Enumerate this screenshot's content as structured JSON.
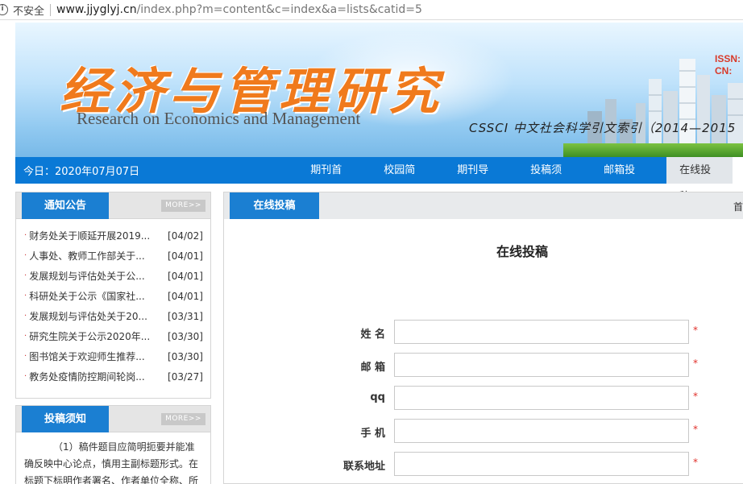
{
  "browser": {
    "security_label": "不安全",
    "url_host": "www.jjyglyj.cn",
    "url_path": "/index.php?m=content&c=index&a=lists&catid=5"
  },
  "banner": {
    "title_cn": "经济与管理研究",
    "title_en": "Research on Economics and Management",
    "index_text": "CSSCI 中文社会科学引文索引（2014—2015",
    "issn_label": "ISSN:",
    "cn_label": "CN:"
  },
  "nav": {
    "date": "今日：2020年07月07日",
    "items": [
      {
        "label": "期刊首页"
      },
      {
        "label": "校园简介"
      },
      {
        "label": "期刊导读"
      },
      {
        "label": "投稿须知"
      },
      {
        "label": "邮箱投稿"
      },
      {
        "label": "在线投稿",
        "active": true
      }
    ]
  },
  "notices": {
    "title": "通知公告",
    "more": "MORE>>",
    "items": [
      {
        "text": "财务处关于顺延开展2019...",
        "date": "[04/02]"
      },
      {
        "text": "人事处、教师工作部关于...",
        "date": "[04/01]"
      },
      {
        "text": "发展规划与评估处关于公...",
        "date": "[04/01]"
      },
      {
        "text": "科研处关于公示《国家社...",
        "date": "[04/01]"
      },
      {
        "text": "发展规划与评估处关于20...",
        "date": "[03/31]"
      },
      {
        "text": "研究生院关于公示2020年...",
        "date": "[03/30]"
      },
      {
        "text": "图书馆关于欢迎师生推荐...",
        "date": "[03/30]"
      },
      {
        "text": "教务处疫情防控期间轮岗...",
        "date": "[03/27]"
      }
    ]
  },
  "guide": {
    "title": "投稿须知",
    "more": "MORE>>",
    "text": "（1）稿件题目应简明扼要并能准确反映中心论点，慎用主副标题形式。在标题下标明作者署名、作者单位全称、所"
  },
  "main": {
    "tab": "在线投稿",
    "crumb": "首",
    "page_title": "在线投稿",
    "required_mark": "*",
    "fields": [
      {
        "label": "姓 名",
        "value": "",
        "placeholder": ""
      },
      {
        "label": "邮 箱",
        "value": "",
        "placeholder": ""
      },
      {
        "label": "qq",
        "value": "",
        "placeholder": ""
      },
      {
        "label": "手 机",
        "value": "",
        "placeholder": ""
      },
      {
        "label": "联系地址",
        "value": "",
        "placeholder": ""
      }
    ]
  },
  "colors": {
    "nav_blue": "#0a79d6",
    "tab_blue": "#1b7fd2",
    "title_orange": "#f07a1c",
    "required_red": "#e0302a"
  }
}
